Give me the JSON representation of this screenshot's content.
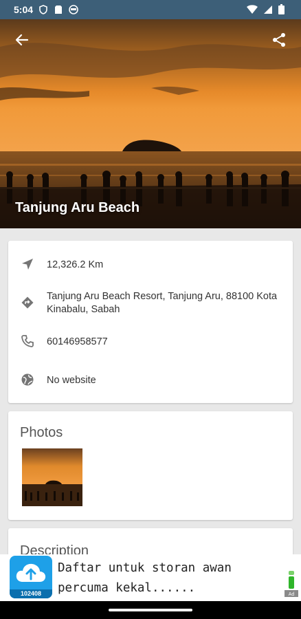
{
  "status_bar": {
    "time": "5:04",
    "left_icons": [
      "shield-icon",
      "sim-card-icon",
      "face-icon"
    ],
    "right_icons": [
      "wifi-icon",
      "signal-icon",
      "battery-icon"
    ]
  },
  "place": {
    "title": "Tanjung Aru Beach"
  },
  "info": {
    "distance": "12,326.2 Km",
    "address": "Tanjung Aru Beach Resort, Tanjung Aru, 88100 Kota Kinabalu, Sabah",
    "phone": "60146958577",
    "website": "No website"
  },
  "photos": {
    "heading": "Photos"
  },
  "description": {
    "heading": "Description"
  },
  "ad": {
    "text": "Daftar untuk storan awan percuma kekal......",
    "logo_number": "102408"
  },
  "colors": {
    "status_bar": "#3d5f78",
    "card_bg": "#ffffff",
    "icon_grey": "#757575"
  }
}
